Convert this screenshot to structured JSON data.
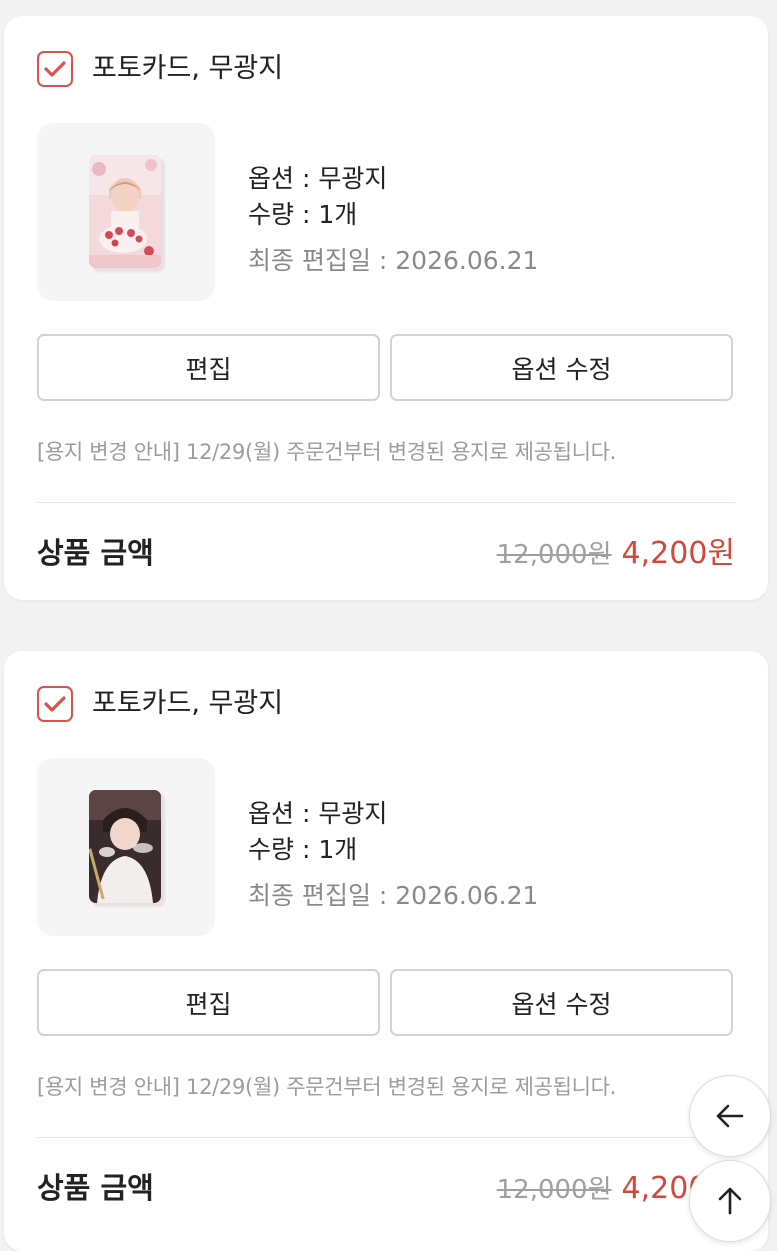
{
  "cards": [
    {
      "title": "포토카드, 무광지",
      "option": "옵션 : 무광지",
      "quantity": "수량 : 1개",
      "last_edit": "최종 편집일 : 2026.06.21",
      "edit_label": "편집",
      "option_edit_label": "옵션 수정",
      "notice": "[용지 변경 안내] 12/29(월) 주문건부터 변경된 용지로 제공됩니다.",
      "price_label": "상품 금액",
      "original_price": "12,000원",
      "sale_price": "4,200원",
      "checked": true
    },
    {
      "title": "포토카드, 무광지",
      "option": "옵션 : 무광지",
      "quantity": "수량 : 1개",
      "last_edit": "최종 편집일 : 2026.06.21",
      "edit_label": "편집",
      "option_edit_label": "옵션 수정",
      "notice": "[용지 변경 안내] 12/29(월) 주문건부터 변경된 용지로 제공됩니다.",
      "price_label": "상품 금액",
      "original_price": "12,000원",
      "sale_price": "4,200원",
      "checked": true
    }
  ],
  "floating": {
    "back_icon": "arrow-left-icon",
    "top_icon": "arrow-up-icon"
  },
  "colors": {
    "accent": "#d4473c",
    "checkbox": "#d9534a",
    "background": "#f2f2f2"
  }
}
